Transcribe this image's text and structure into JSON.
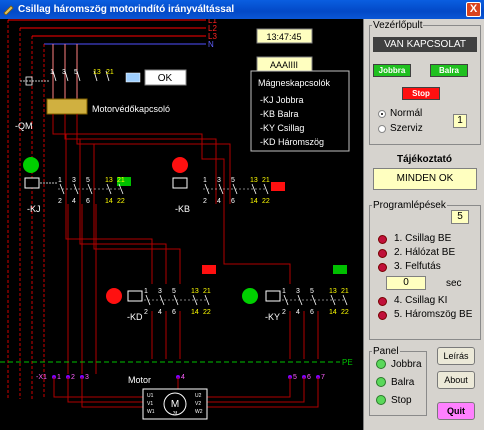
{
  "window": {
    "title": "Csillag háromszög motorindító irányváltással",
    "close_glyph": "X"
  },
  "diagram": {
    "phases": [
      "L1",
      "L2",
      "L3",
      "N"
    ],
    "pe_label": "PE",
    "clock": "13:47:45",
    "code": "AAAIIII",
    "ok_label": "OK",
    "qm_label": "-QM",
    "qm_name": "Motorvédőkapcsoló",
    "contactors": {
      "title": "Mágneskapcsolók",
      "items": [
        "-KJ  Jobbra",
        "-KB  Balra",
        "-KY  Csillag",
        "-KD  Háromszög"
      ]
    },
    "kj": "-KJ",
    "kb": "-KB",
    "kd": "-KD",
    "ky": "-KY",
    "contact_top": [
      "1",
      "3",
      "5",
      "13",
      "21"
    ],
    "contact_bottom": [
      "2",
      "4",
      "6",
      "14",
      "22"
    ],
    "qm_top": [
      "1",
      "3",
      "5",
      "13",
      "21"
    ],
    "motor_label": "Motor",
    "motor_symbol": "M",
    "motor_phase": "3f",
    "motor_terms": [
      "U1",
      "V1",
      "W1",
      "U2",
      "V2",
      "W2"
    ],
    "terminals_left": [
      "-X1",
      "1",
      "2",
      "3"
    ],
    "terminals_mid": "4",
    "terminals_right": [
      "5",
      "6",
      "7"
    ]
  },
  "panel": {
    "control": {
      "legend": "Vezérlőpult",
      "status": "VAN KAPCSOLAT",
      "right_btn": "Jobbra",
      "left_btn": "Balra",
      "stop_btn": "Stop",
      "mode_normal": "Normál",
      "mode_service": "Szerviz",
      "mode_value": "1"
    },
    "info": {
      "title": "Tájékoztató",
      "message": "MINDEN OK"
    },
    "steps": {
      "legend": "Programlépések",
      "count": "5",
      "items": [
        "1. Csillag BE",
        "2. Hálózat BE",
        "3. Felfutás",
        "4. Csillag KI",
        "5. Háromszög BE"
      ],
      "delay_value": "0",
      "delay_unit": "sec"
    },
    "indicators": {
      "legend": "Panel",
      "items": [
        "Jobbra",
        "Balra",
        "Stop"
      ]
    },
    "buttons": {
      "help": "Leírás",
      "about": "About",
      "quit": "Quit"
    }
  },
  "colors": {
    "red_line": "#ff0000",
    "dark_red_line": "#b00000",
    "pe_line": "#00c000",
    "green_led": "#00d000",
    "red_led": "#ff1010",
    "yellow_contact": "#ffff00",
    "panel_bg": "#d6d3ce",
    "title_blue": "#0349c7"
  }
}
